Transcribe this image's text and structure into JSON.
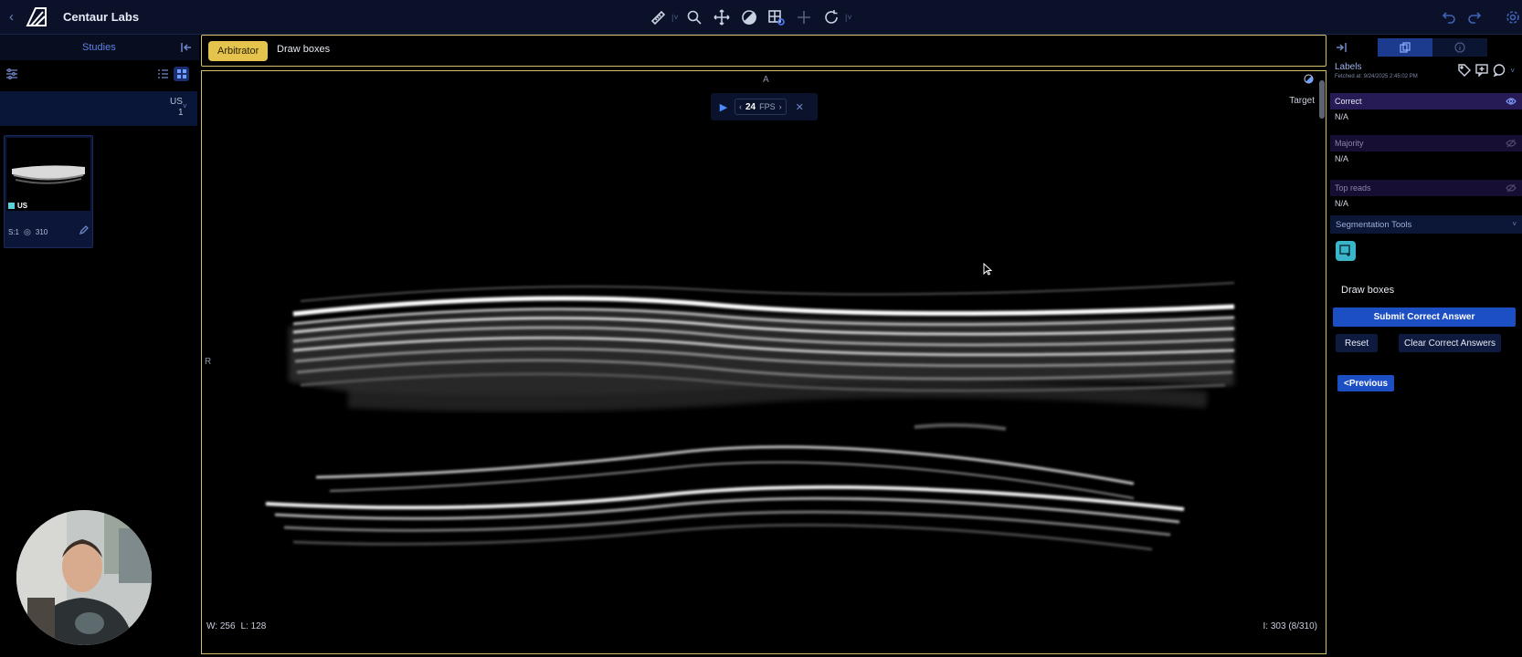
{
  "app": {
    "title": "Centaur Labs",
    "back_icon": "chevron-left-icon"
  },
  "toolbar": {
    "tools": [
      "ruler-icon",
      "zoom-icon",
      "pan-icon",
      "contrast-icon",
      "layout-icon",
      "crosshair-icon",
      "rotate-icon"
    ]
  },
  "left_panel": {
    "studies_label": "Studies",
    "study": {
      "modality": "US",
      "count": "1"
    },
    "thumbnail": {
      "modality": "US",
      "series": "S:1",
      "frames": "310"
    }
  },
  "header": {
    "badge": "Arbitrator",
    "task_title": "Draw boxes"
  },
  "viewport": {
    "orientation_top": "A",
    "orientation_left": "R",
    "target_label": "Target",
    "window_width": "W: 256",
    "window_level": "L: 128",
    "image_index": "I: 303 (8/310)",
    "player": {
      "fps_value": "24",
      "fps_unit": "FPS"
    }
  },
  "right_panel": {
    "labels_title": "Labels",
    "fetched_at": "Fetched at: 9/24/2025 2:45:02 PM",
    "sections": {
      "correct": {
        "title": "Correct",
        "value": "N/A"
      },
      "majority": {
        "title": "Majority",
        "value": "N/A"
      },
      "top_reads": {
        "title": "Top reads",
        "value": "N/A"
      }
    },
    "segmentation_title": "Segmentation Tools",
    "draw_label": "Draw boxes",
    "submit_label": "Submit Correct Answer",
    "reset_label": "Reset",
    "clear_label": "Clear Correct Answers",
    "previous_label": "<Previous"
  },
  "colors": {
    "accent": "#1d4fc4",
    "arbitrator": "#e5c44e",
    "frame_border": "#d7c06a",
    "topbar": "#0a1129"
  }
}
